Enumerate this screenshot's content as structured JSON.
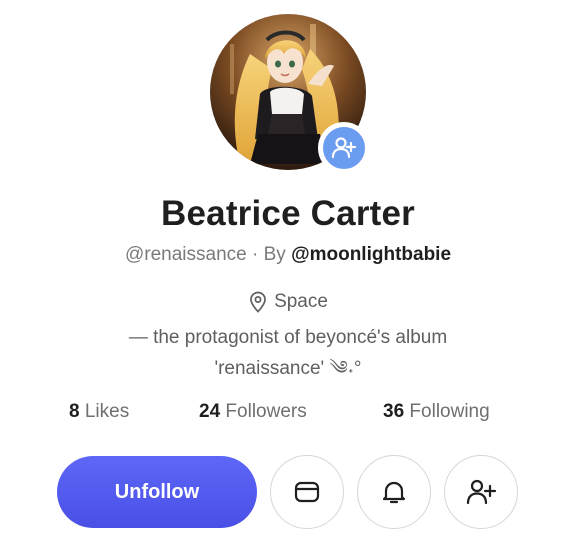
{
  "profile": {
    "name": "Beatrice Carter",
    "handle": "@renaissance",
    "separator": "· By",
    "author": "@moonlightbabie",
    "location": "Space",
    "bio_line1": "— the protagonist of beyoncé's album",
    "bio_line2": "'renaissance' ༄˖°"
  },
  "stats": {
    "likes_count": "8",
    "likes_label": "Likes",
    "followers_count": "24",
    "followers_label": "Followers",
    "following_count": "36",
    "following_label": "Following"
  },
  "actions": {
    "unfollow_label": "Unfollow",
    "message_icon": "message-icon",
    "bell_icon": "bell-icon",
    "add_user_icon": "add-user-icon"
  },
  "colors": {
    "accent": "#5058ef",
    "avatar_badge": "#6a9cf0",
    "text_primary": "#1f1f1f",
    "text_secondary": "#6f6f6f"
  }
}
